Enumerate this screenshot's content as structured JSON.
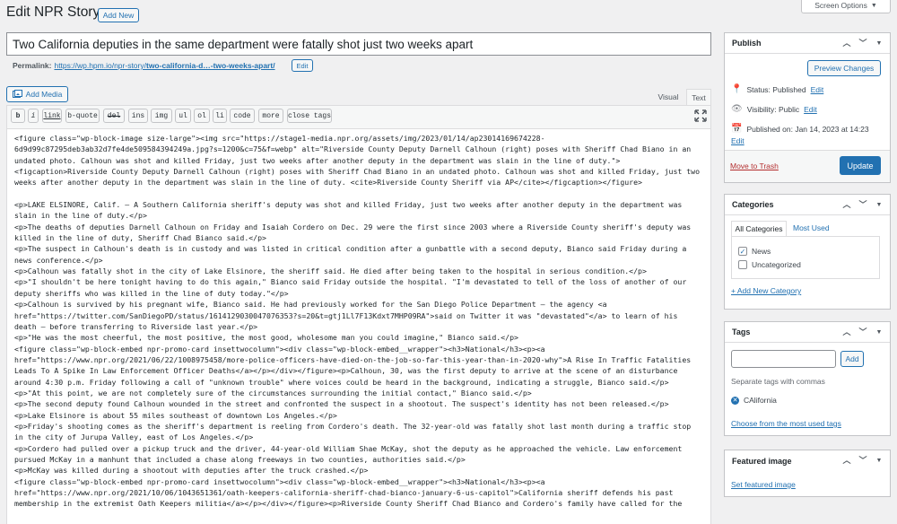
{
  "header": {
    "title": "Edit NPR Story",
    "add_new": "Add New",
    "screen_options": "Screen Options"
  },
  "post": {
    "title": "Two California deputies in the same department were fatally shot just two weeks apart",
    "permalink_label": "Permalink:",
    "permalink_base": "https://wp.hpm.io/npr-story/",
    "permalink_slug": "two-california-d…-two-weeks-apart/",
    "permalink_edit": "Edit"
  },
  "editor": {
    "add_media": "Add Media",
    "tab_visual": "Visual",
    "tab_text": "Text",
    "quicktags": [
      "b",
      "i",
      "link",
      "b-quote",
      "del",
      "ins",
      "img",
      "ul",
      "ol",
      "li",
      "code",
      "more",
      "close tags"
    ],
    "content": "<figure class=\"wp-block-image size-large\"><img src=\"https://stage1-media.npr.org/assets/img/2023/01/14/ap23014169674228-6d9d99c87295deb3ab32d7fe4de509584394249a.jpg?s=1200&c=75&f=webp\" alt=\"Riverside County Deputy Darnell Calhoun (right) poses with Sheriff Chad Biano in an undated photo. Calhoun was shot and killed Friday, just two weeks after another deputy in the department was slain in the line of duty.\">\n<figcaption>Riverside County Deputy Darnell Calhoun (right) poses with Sheriff Chad Biano in an undated photo. Calhoun was shot and killed Friday, just two weeks after another deputy in the department was slain in the line of duty. <cite>Riverside County Sheriff via AP</cite></figcaption></figure>\n\n<p>LAKE ELSINORE, Calif. — A Southern California sheriff's deputy was shot and killed Friday, just two weeks after another deputy in the department was slain in the line of duty.</p>\n<p>The deaths of deputies Darnell Calhoun on Friday and Isaiah Cordero on Dec. 29 were the first since 2003 where a Riverside County sheriff's deputy was killed in the line of duty, Sheriff Chad Bianco said.</p>\n<p>The suspect in Calhoun's death is in custody and was listed in critical condition after a gunbattle with a second deputy, Bianco said Friday during a news conference.</p>\n<p>Calhoun was fatally shot in the city of Lake Elsinore, the sheriff said. He died after being taken to the hospital in serious condition.</p>\n<p>\"I shouldn't be here tonight having to do this again,\" Bianco said Friday outside the hospital. \"I'm devastated to tell of the loss of another of our deputy sheriffs who was killed in the line of duty today.\"</p>\n<p>Calhoun is survived by his pregnant wife, Bianco said. He had previously worked for the San Diego Police Department — the agency <a href=\"https://twitter.com/SanDiegoPD/status/1614129030047076353?s=20&t=gtj1Ll7F13Kdxt7MHP09RA\">said on Twitter it was \"devastated\"</a> to learn of his death — before transferring to Riverside last year.</p>\n<p>\"He was the most cheerful, the most positive, the most good, wholesome man you could imagine,\" Bianco said.</p>\n<figure class=\"wp-block-embed npr-promo-card insettwocolumn\"><div class=\"wp-block-embed__wrapper\"><h3>National</h3><p><a href=\"https://www.npr.org/2021/06/22/1008975458/more-police-officers-have-died-on-the-job-so-far-this-year-than-in-2020-why\">A Rise In Traffic Fatalities Leads To A Spike In Law Enforcement Officer Deaths</a></p></div></figure><p>Calhoun, 30, was the first deputy to arrive at the scene of an disturbance around 4:30 p.m. Friday following a call of \"unknown trouble\" where voices could be heard in the background, indicating a struggle, Bianco said.</p>\n<p>\"At this point, we are not completely sure of the circumstances surrounding the initial contact,\" Bianco said.</p>\n<p>The second deputy found Calhoun wounded in the street and confronted the suspect in a shootout. The suspect's identity has not been released.</p>\n<p>Lake Elsinore is about 55 miles southeast of downtown Los Angeles.</p>\n<p>Friday's shooting comes as the sheriff's department is reeling from Cordero's death. The 32-year-old was fatally shot last month during a traffic stop in the city of Jurupa Valley, east of Los Angeles.</p>\n<p>Cordero had pulled over a pickup truck and the driver, 44-year-old William Shae McKay, shot the deputy as he approached the vehicle. Law enforcement pursued McKay in a manhunt that included a chase along freeways in two counties, authorities said.</p>\n<p>McKay was killed during a shootout with deputies after the truck crashed.</p>\n<figure class=\"wp-block-embed npr-promo-card insettwocolumn\"><div class=\"wp-block-embed__wrapper\"><h3>National</h3><p><a href=\"https://www.npr.org/2021/10/06/1043651361/oath-keepers-california-sheriff-chad-bianco-january-6-us-capitol\">California sheriff defends his past membership in the extremist Oath Keepers militia</a></p></div></figure><p>Riverside County Sheriff Chad Bianco and Cordero's family have called for the"
  },
  "publish": {
    "title": "Publish",
    "preview": "Preview Changes",
    "status_label": "Status: Published",
    "status_edit": "Edit",
    "visibility_label": "Visibility: Public",
    "visibility_edit": "Edit",
    "published_label": "Published on: Jan 14, 2023 at 14:23",
    "published_edit": "Edit",
    "trash": "Move to Trash",
    "update": "Update"
  },
  "categories": {
    "title": "Categories",
    "tab_all": "All Categories",
    "tab_used": "Most Used",
    "items": [
      {
        "label": "News",
        "checked": true
      },
      {
        "label": "Uncategorized",
        "checked": false
      }
    ],
    "add_new": "+ Add New Category"
  },
  "tags": {
    "title": "Tags",
    "add": "Add",
    "hint": "Separate tags with commas",
    "tag": "CAlifornia",
    "choose": "Choose from the most used tags"
  },
  "featured": {
    "title": "Featured image",
    "set": "Set featured image"
  },
  "colors": {
    "accent": "#2271b1",
    "trash": "#b32d2e",
    "background": "#f0f0f1"
  }
}
